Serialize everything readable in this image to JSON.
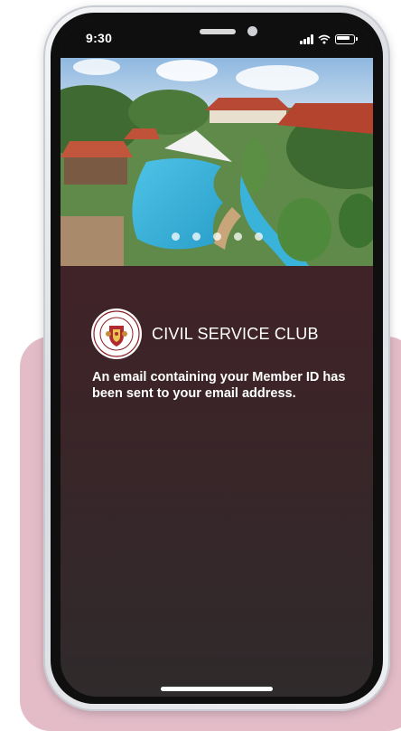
{
  "status_bar": {
    "time": "9:30",
    "icons": [
      "signal-icon",
      "wifi-icon",
      "battery-icon"
    ]
  },
  "carousel": {
    "image": "resort-pool-photo",
    "slide_count": 5,
    "active_index": 0
  },
  "brand": {
    "name": "CIVIL SERVICE CLUB",
    "logo_ring_top": "CIVIL SERVICE CLUB",
    "logo_ring_bottom": "SINGAPORE"
  },
  "message": "An email containing your Member ID has been sent to your email address.",
  "colors": {
    "accent_background": "#e3bcc8",
    "screen_top": "#4a2227",
    "screen_bottom": "#2f2a2b"
  }
}
